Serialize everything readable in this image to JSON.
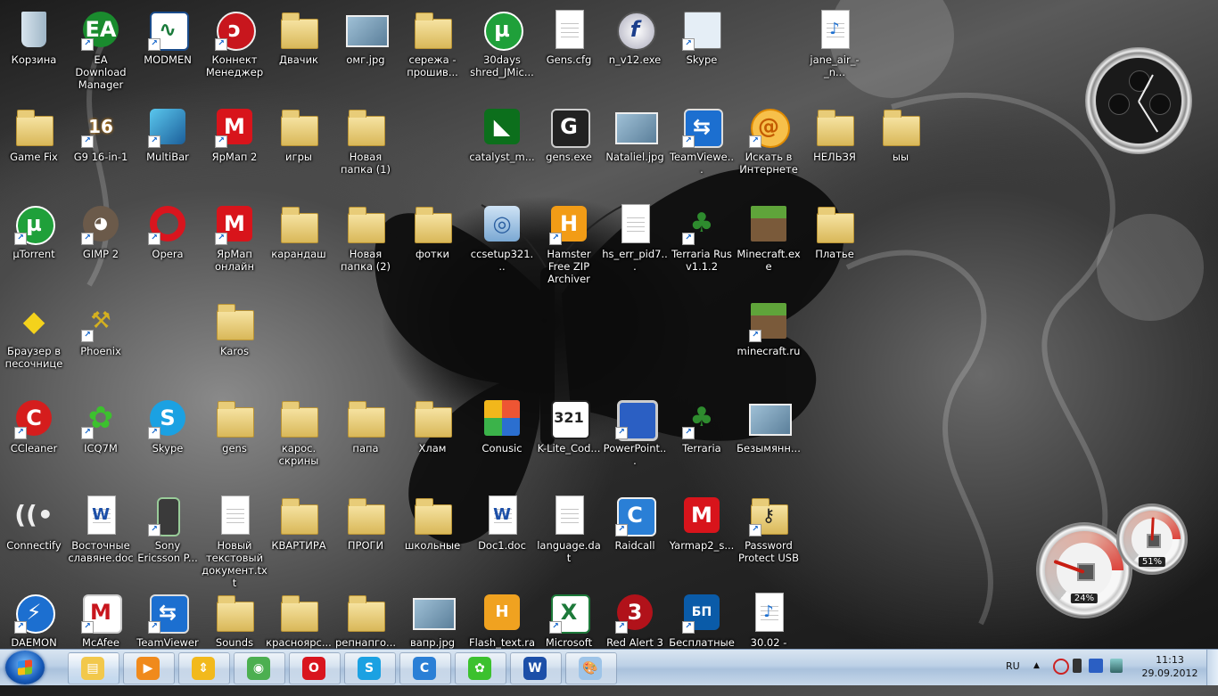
{
  "desktop": {
    "icons": [
      {
        "id": "recycle-bin",
        "label": "Корзина",
        "kind": "bin",
        "col": 0,
        "row": 0
      },
      {
        "id": "ea-download-manager",
        "label": "EA Download Manager",
        "kind": "ea",
        "col": 1,
        "row": 0,
        "shortcut": true
      },
      {
        "id": "modmen",
        "label": "MODMEN",
        "kind": "chart",
        "col": 2,
        "row": 0,
        "shortcut": true
      },
      {
        "id": "konnekt-menedzher",
        "label": "Коннект Менеджер",
        "kind": "redround",
        "col": 3,
        "row": 0,
        "shortcut": true
      },
      {
        "id": "dvachik",
        "label": "Двачик",
        "kind": "folder",
        "col": 4,
        "row": 0
      },
      {
        "id": "omg-jpg",
        "label": "омг.jpg",
        "kind": "pic",
        "col": 5,
        "row": 0
      },
      {
        "id": "serezha",
        "label": "сережа - прошив...",
        "kind": "folder",
        "col": 6,
        "row": 0
      },
      {
        "id": "30days",
        "label": "30days shred_JMic...",
        "kind": "utorrent",
        "col": 7,
        "row": 0
      },
      {
        "id": "gens-cfg",
        "label": "Gens.cfg",
        "kind": "doc",
        "col": 8,
        "row": 0
      },
      {
        "id": "n-v12",
        "label": "n_v12.exe",
        "kind": "flash",
        "col": 9,
        "row": 0
      },
      {
        "id": "skype-top",
        "label": "Skype",
        "kind": "window",
        "col": 10,
        "row": 0,
        "shortcut": true
      },
      {
        "id": "jane-air",
        "label": "jane_air_-_n...",
        "kind": "mp3",
        "col": 12,
        "row": 0
      },
      {
        "id": "game-fix",
        "label": "Game Fix",
        "kind": "folder",
        "col": 0,
        "row": 1
      },
      {
        "id": "g9-16in1",
        "label": "G9 16-in-1",
        "kind": "g16",
        "col": 1,
        "row": 1,
        "shortcut": true
      },
      {
        "id": "multibar",
        "label": "MultiBar",
        "kind": "multibar",
        "col": 2,
        "row": 1,
        "shortcut": true
      },
      {
        "id": "yarmap2",
        "label": "ЯрМап 2",
        "kind": "yarmap",
        "col": 3,
        "row": 1,
        "shortcut": true
      },
      {
        "id": "igry",
        "label": "игры",
        "kind": "folder",
        "col": 4,
        "row": 1
      },
      {
        "id": "new-folder-1",
        "label": "Новая папка (1)",
        "kind": "folder",
        "col": 5,
        "row": 1
      },
      {
        "id": "catalyst",
        "label": "catalyst_m...",
        "kind": "amd",
        "col": 7,
        "row": 1
      },
      {
        "id": "gens-exe",
        "label": "gens.exe",
        "kind": "gens",
        "col": 8,
        "row": 1
      },
      {
        "id": "nataliel",
        "label": "Nataliel.jpg",
        "kind": "pic",
        "col": 9,
        "row": 1
      },
      {
        "id": "teamviewer-top",
        "label": "TeamViewe...",
        "kind": "teamviewer",
        "col": 10,
        "row": 1,
        "shortcut": true
      },
      {
        "id": "search-internet",
        "label": "Искать в Интернете",
        "kind": "search",
        "col": 11,
        "row": 1,
        "shortcut": true
      },
      {
        "id": "nelzya",
        "label": "НЕЛЬЗЯ",
        "kind": "folder",
        "col": 12,
        "row": 1
      },
      {
        "id": "yy",
        "label": "ыы",
        "kind": "folder",
        "col": 13,
        "row": 1
      },
      {
        "id": "utorrent",
        "label": "µTorrent",
        "kind": "utorrent",
        "col": 0,
        "row": 2,
        "shortcut": true
      },
      {
        "id": "gimp2",
        "label": "GIMP 2",
        "kind": "gimp",
        "col": 1,
        "row": 2,
        "shortcut": true
      },
      {
        "id": "opera",
        "label": "Opera",
        "kind": "opera",
        "col": 2,
        "row": 2,
        "shortcut": true
      },
      {
        "id": "yarmap-online",
        "label": "ЯрМап онлайн",
        "kind": "yarmap",
        "col": 3,
        "row": 2,
        "shortcut": true
      },
      {
        "id": "karandash",
        "label": "карандаш",
        "kind": "folder",
        "col": 4,
        "row": 2
      },
      {
        "id": "new-folder-2",
        "label": "Новая папка (2)",
        "kind": "folder",
        "col": 5,
        "row": 2
      },
      {
        "id": "fotki",
        "label": "фотки",
        "kind": "folder",
        "col": 6,
        "row": 2
      },
      {
        "id": "ccsetup",
        "label": "ccsetup321...",
        "kind": "installer",
        "col": 7,
        "row": 2
      },
      {
        "id": "hamster",
        "label": "Hamster Free ZIP Archiver",
        "kind": "hamster",
        "col": 8,
        "row": 2,
        "shortcut": true
      },
      {
        "id": "hs-err",
        "label": "hs_err_pid7...",
        "kind": "doc",
        "col": 9,
        "row": 2
      },
      {
        "id": "terraria-rus",
        "label": "Terraria Rus v1.1.2",
        "kind": "tree",
        "col": 10,
        "row": 2,
        "shortcut": true
      },
      {
        "id": "minecraft-exe",
        "label": "Minecraft.exe",
        "kind": "grass",
        "col": 11,
        "row": 2
      },
      {
        "id": "platye",
        "label": "Платье",
        "kind": "folder",
        "col": 12,
        "row": 2
      },
      {
        "id": "sandbox-browser",
        "label": "Браузер в песочнице",
        "kind": "sandbox",
        "col": 0,
        "row": 3
      },
      {
        "id": "phoenix",
        "label": "Phoenix",
        "kind": "tools",
        "col": 1,
        "row": 3,
        "shortcut": true
      },
      {
        "id": "karos",
        "label": "Karos",
        "kind": "folder",
        "col": 3,
        "row": 3
      },
      {
        "id": "minecraft-ru",
        "label": "minecraft.ru",
        "kind": "grass",
        "col": 11,
        "row": 3,
        "shortcut": true
      },
      {
        "id": "ccleaner",
        "label": "CCleaner",
        "kind": "ccleaner",
        "col": 0,
        "row": 4,
        "shortcut": true
      },
      {
        "id": "icq7m",
        "label": "ICQ7M",
        "kind": "icq",
        "col": 1,
        "row": 4,
        "shortcut": true
      },
      {
        "id": "skype",
        "label": "Skype",
        "kind": "skype",
        "col": 2,
        "row": 4,
        "shortcut": true
      },
      {
        "id": "gens-folder",
        "label": "gens",
        "kind": "folder",
        "col": 3,
        "row": 4
      },
      {
        "id": "karos-skriny",
        "label": "карос. скрины",
        "kind": "folder",
        "col": 4,
        "row": 4
      },
      {
        "id": "papa",
        "label": "папа",
        "kind": "folder",
        "col": 5,
        "row": 4
      },
      {
        "id": "hlam",
        "label": "Хлам",
        "kind": "folder",
        "col": 6,
        "row": 4
      },
      {
        "id": "conusic",
        "label": "Conusic",
        "kind": "conusic",
        "col": 7,
        "row": 4
      },
      {
        "id": "klite",
        "label": "K-Lite_Cod...",
        "kind": "klite",
        "col": 8,
        "row": 4
      },
      {
        "id": "powerpoint",
        "label": "PowerPoint...",
        "kind": "computer",
        "col": 9,
        "row": 4,
        "shortcut": true
      },
      {
        "id": "terraria",
        "label": "Terraria",
        "kind": "tree",
        "col": 10,
        "row": 4,
        "shortcut": true
      },
      {
        "id": "untitled",
        "label": "Безымянн...",
        "kind": "pic",
        "col": 11,
        "row": 4
      },
      {
        "id": "connectify",
        "label": "Connectify",
        "kind": "wifi",
        "col": 0,
        "row": 5
      },
      {
        "id": "vostochnye",
        "label": "Восточные славяне.doc",
        "kind": "word",
        "col": 1,
        "row": 5
      },
      {
        "id": "sony-ericsson",
        "label": "Sony Ericsson P...",
        "kind": "phone",
        "col": 2,
        "row": 5,
        "shortcut": true
      },
      {
        "id": "new-text-doc",
        "label": "Новый текстовый документ.txt",
        "kind": "doc",
        "col": 3,
        "row": 5
      },
      {
        "id": "kvartira",
        "label": "КВАРТИРА",
        "kind": "folder",
        "col": 4,
        "row": 5
      },
      {
        "id": "progi",
        "label": "ПРОГИ",
        "kind": "folder",
        "col": 5,
        "row": 5
      },
      {
        "id": "shkolnye",
        "label": "школьные",
        "kind": "folder",
        "col": 6,
        "row": 5
      },
      {
        "id": "doc1",
        "label": "Doc1.doc",
        "kind": "word",
        "col": 7,
        "row": 5
      },
      {
        "id": "language-dat",
        "label": "language.dat",
        "kind": "doc",
        "col": 8,
        "row": 5
      },
      {
        "id": "raidcall",
        "label": "Raidcall",
        "kind": "raidcall",
        "col": 9,
        "row": 5,
        "shortcut": true
      },
      {
        "id": "yarmap2-s",
        "label": "Yarmap2_s...",
        "kind": "yarmap",
        "col": 10,
        "row": 5
      },
      {
        "id": "password-protect",
        "label": "Password Protect USB",
        "kind": "keyfolder",
        "col": 11,
        "row": 5,
        "shortcut": true
      },
      {
        "id": "daemon",
        "label": "DAEMON",
        "kind": "daemon",
        "col": 0,
        "row": 6,
        "shortcut": true
      },
      {
        "id": "mcafee",
        "label": "McAfee",
        "kind": "mcafee",
        "col": 1,
        "row": 6,
        "shortcut": true
      },
      {
        "id": "teamviewer",
        "label": "TeamViewer",
        "kind": "teamviewer",
        "col": 2,
        "row": 6,
        "shortcut": true
      },
      {
        "id": "sounds",
        "label": "Sounds",
        "kind": "folder",
        "col": 3,
        "row": 6
      },
      {
        "id": "krasnoyarsk",
        "label": "красноярс...",
        "kind": "folder",
        "col": 4,
        "row": 6
      },
      {
        "id": "repnapg",
        "label": "репнапго...",
        "kind": "folder",
        "col": 5,
        "row": 6
      },
      {
        "id": "vapr-jpg",
        "label": "вапр.jpg",
        "kind": "pic",
        "col": 6,
        "row": 6
      },
      {
        "id": "flash-text-rar",
        "label": "Flash_text.rar",
        "kind": "rar",
        "col": 7,
        "row": 6
      },
      {
        "id": "excel",
        "label": "Microsoft",
        "kind": "excel",
        "col": 8,
        "row": 6,
        "shortcut": true
      },
      {
        "id": "red-alert",
        "label": "Red Alert 3",
        "kind": "redalert",
        "col": 9,
        "row": 6,
        "shortcut": true
      },
      {
        "id": "besplatnye",
        "label": "Бесплатные",
        "kind": "beeline",
        "col": 10,
        "row": 6,
        "shortcut": true
      },
      {
        "id": "mp3-3002",
        "label": "30.02 -",
        "kind": "mp3",
        "col": 11,
        "row": 6
      }
    ]
  },
  "gadgets": {
    "cpu_percent": "24%",
    "mem_percent": "51%",
    "cpu_level": 0.24,
    "mem_level": 0.51
  },
  "taskbar": {
    "pinned": [
      {
        "id": "explorer",
        "kind": "explorer",
        "active": true
      },
      {
        "id": "media-player",
        "kind": "media"
      },
      {
        "id": "ubar",
        "kind": "ubar"
      },
      {
        "id": "chrome",
        "kind": "chrome"
      },
      {
        "id": "opera",
        "kind": "opera"
      },
      {
        "id": "skype",
        "kind": "skype"
      },
      {
        "id": "raidcall",
        "kind": "raidcall"
      },
      {
        "id": "icq",
        "kind": "icq"
      },
      {
        "id": "word",
        "kind": "word"
      },
      {
        "id": "paint",
        "kind": "paint"
      }
    ],
    "tray": {
      "language": "RU",
      "time": "11:13",
      "date": "29.09.2012"
    }
  },
  "colors": {
    "taskbar": "#bcd0e6",
    "label_text": "#ffffff"
  }
}
